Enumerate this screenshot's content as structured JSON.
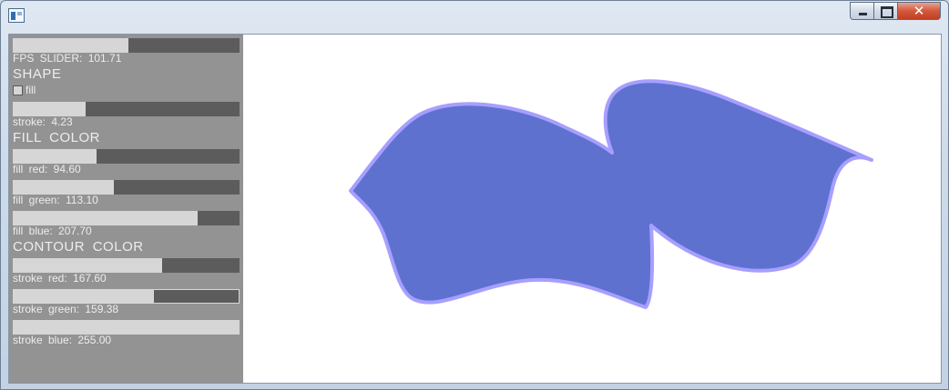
{
  "window": {
    "title": ""
  },
  "gui": {
    "fps_label": "FPS  SLIDER:  101.71",
    "fps_fraction": 0.51,
    "shape_header": "SHAPE",
    "fill_toggle": {
      "label": "fill",
      "checked": false
    },
    "stroke_label": "stroke:  4.23",
    "stroke_fraction": 0.32,
    "fill_color_header": "FILL  COLOR",
    "fill_red_label": "fill  red:  94.60",
    "fill_red_fraction": 0.371,
    "fill_green_label": "fill  green:  113.10",
    "fill_green_fraction": 0.444,
    "fill_blue_label": "fill  blue:  207.70",
    "fill_blue_fraction": 0.815,
    "contour_color_header": "CONTOUR  COLOR",
    "stroke_red_label": "stroke  red:  167.60",
    "stroke_red_fraction": 0.657,
    "stroke_green_label": "stroke  green:  159.38",
    "stroke_green_fraction": 0.625,
    "stroke_blue_label": "stroke  blue:  255.00",
    "stroke_blue_fraction": 1.0
  },
  "colors": {
    "shape_fill": "#5e71cf",
    "shape_stroke": "#a79fff"
  }
}
